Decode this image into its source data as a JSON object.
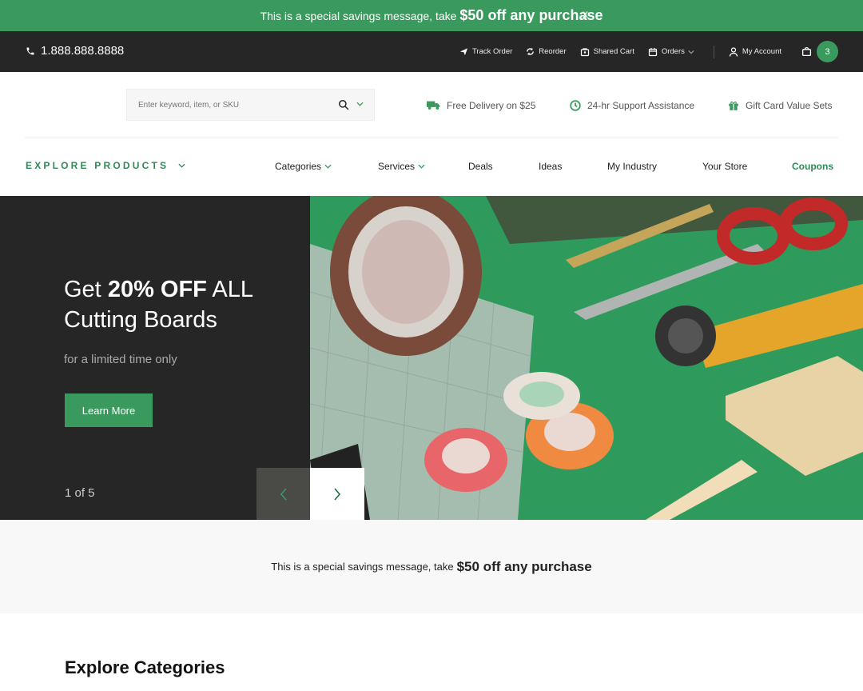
{
  "promo": {
    "text": "This is a special savings message, take",
    "highlight": "$50 off any purchase",
    "close": "x"
  },
  "utility": {
    "phone": "1.888.888.8888",
    "links": {
      "track": "Track Order",
      "reorder": "Reorder",
      "shared": "Shared Cart",
      "orders": "Orders",
      "account": "My Account"
    },
    "cart_count": "3"
  },
  "search": {
    "placeholder": "Enter keyword, item, or SKU"
  },
  "perks": {
    "delivery": "Free Delivery on $25",
    "support": "24-hr Support Assistance",
    "gift": "Gift Card Value Sets"
  },
  "nav": {
    "explore": "EXPLORE PRODUCTS",
    "categories": "Categories",
    "services": "Services",
    "deals": "Deals",
    "ideas": "Ideas",
    "industry": "My Industry",
    "store": "Your Store",
    "coupons": "Coupons"
  },
  "hero": {
    "pre": "Get",
    "bold": "20% OFF",
    "post": "ALL",
    "line2": "Cutting Boards",
    "sub": "for a limited time only",
    "button": "Learn More",
    "counter": "1 of 5"
  },
  "band": {
    "text": "This is a special savings message, take",
    "highlight": "$50 off any purchase"
  },
  "section": {
    "title": "Explore Categories"
  },
  "colors": {
    "brand_green": "#3a9a5e",
    "dark": "#262626"
  }
}
